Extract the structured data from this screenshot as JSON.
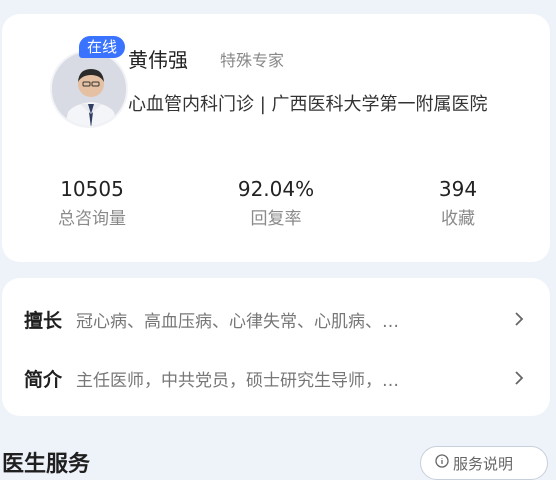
{
  "doctor": {
    "online_badge": "在线",
    "name": "黄伟强",
    "tag": "特殊专家",
    "department": "心血管内科门诊 | 广西医科大学第一附属医院"
  },
  "stats": [
    {
      "value": "10505",
      "label": "总咨询量"
    },
    {
      "value": "92.04%",
      "label": "回复率"
    },
    {
      "value": "394",
      "label": "收藏"
    }
  ],
  "info": {
    "specialty_title": "擅长",
    "specialty_text": "冠心病、高血压病、心律失常、心肌病、…",
    "intro_title": "简介",
    "intro_text": "主任医师，中共党员，硕士研究生导师，…"
  },
  "section": {
    "title": "医生服务",
    "service_link": "服务说明"
  },
  "icons": {
    "chevron": "chevron-right-icon",
    "service": "info-circle-icon"
  },
  "colors": {
    "accent": "#3a73ff",
    "background": "#eef2f9"
  }
}
